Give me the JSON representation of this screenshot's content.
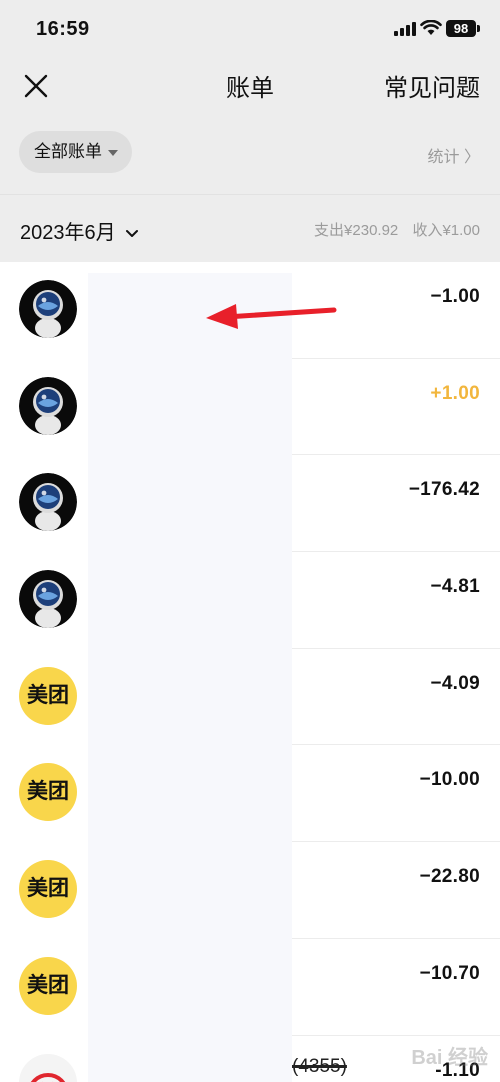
{
  "status_bar": {
    "time": "16:59",
    "battery": "98"
  },
  "nav": {
    "title": "账单",
    "right_link": "常见问题"
  },
  "filter": {
    "chip_label": "全部账单",
    "stats_label": "统计 〉"
  },
  "month": {
    "label": "2023年6月",
    "expense": "支出¥230.92",
    "income": "收入¥1.00"
  },
  "transactions": [
    {
      "avatar": "astronaut",
      "amount": "−1.00",
      "type": "expense"
    },
    {
      "avatar": "astronaut",
      "amount": "+1.00",
      "type": "income"
    },
    {
      "avatar": "astronaut",
      "amount": "−176.42",
      "type": "expense"
    },
    {
      "avatar": "astronaut",
      "amount": "−4.81",
      "type": "expense"
    },
    {
      "avatar": "meituan",
      "avatar_text": "美团",
      "amount": "−4.09",
      "type": "expense"
    },
    {
      "avatar": "meituan",
      "avatar_text": "美团",
      "amount": "−10.00",
      "type": "expense"
    },
    {
      "avatar": "meituan",
      "avatar_text": "美团",
      "amount": "−22.80",
      "type": "expense"
    },
    {
      "avatar": "meituan",
      "avatar_text": "美团",
      "amount": "−10.70",
      "type": "expense"
    },
    {
      "avatar": "metro",
      "amount": "-1.10",
      "type": "expense",
      "partial_text": "(4355)"
    }
  ],
  "watermark": "Bai 经验",
  "colors": {
    "income": "#f2b63d",
    "meituan": "#f9d64b",
    "background": "#ededed",
    "arrow": "#e8202a"
  }
}
